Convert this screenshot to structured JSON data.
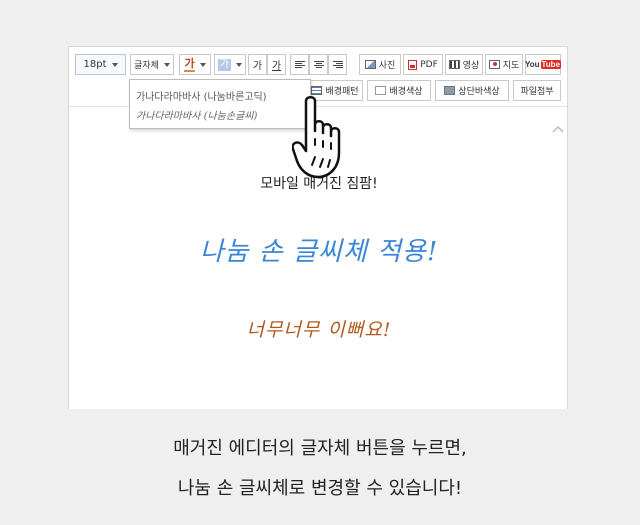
{
  "toolbar": {
    "font_size": "18pt",
    "font_family": "글자체",
    "font_color_glyph": "가",
    "highlight_glyph": "가",
    "style_glyph_1": "가",
    "style_glyph_2": "가",
    "photo": "사진",
    "pdf": "PDF",
    "video": "영상",
    "map": "지도",
    "youtube_you": "You",
    "youtube_tube": "Tube",
    "bg_pattern": "배경패턴",
    "bg_color": "배경색상",
    "top_bar_color": "상단바색상",
    "attach_file": "파일첨부"
  },
  "font_menu": {
    "options": [
      "가나다라마바사 (나눔바른고딕)",
      "가나다라마바사 (나눔손글씨)"
    ]
  },
  "content": {
    "line1": "모바일 매거진 짐팜!",
    "line2": "나눔 손 글씨체 적용!",
    "line3": "너무너무 이뻐요!"
  },
  "caption": {
    "line1": "매거진 에디터의 글자체 버튼을 누르면,",
    "line2": "나눔 손 글씨체로 변경할 수 있습니다!"
  },
  "colors": {
    "handwriting_blue": "#3a86d6",
    "handwriting_brown": "#b05a1e",
    "page_bg": "#efefef"
  }
}
